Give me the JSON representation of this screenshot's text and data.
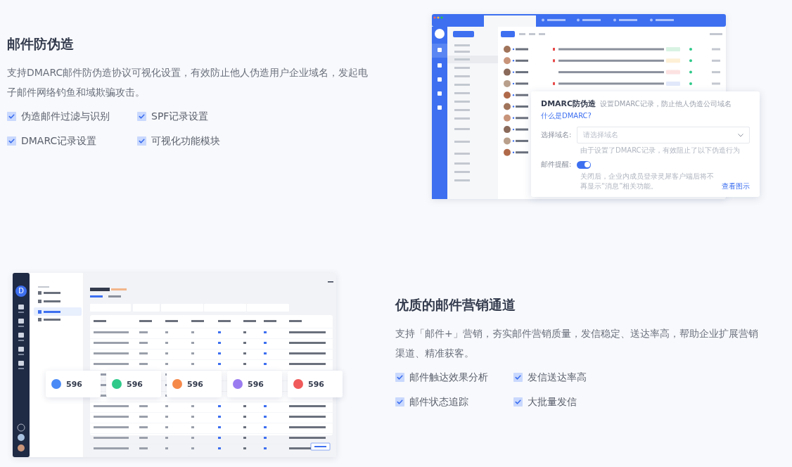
{
  "sections": [
    {
      "title": "邮件防伪造",
      "description": "支持DMARC邮件防伪造协议可视化设置，有效防止他人伪造用户企业域名，发起电子邮件网络钓鱼和域欺骗攻击。",
      "features": [
        {
          "label": "伪造邮件过滤与识别",
          "checked": true
        },
        {
          "label": "SPF记录设置",
          "checked": true
        },
        {
          "label": "DMARC记录设置",
          "checked": true
        },
        {
          "label": "可视化功能模块",
          "checked": true
        }
      ],
      "preview": {
        "kind": "mail_client",
        "dmarc_card": {
          "title": "DMARC防伪造",
          "subtitle": "设置DMARC记录，防止他人伪造公司域名",
          "help_link": "什么是DMARC?",
          "domain_label": "选择域名:",
          "domain_placeholder": "请选择域名",
          "domain_note": "由于设置了DMARC记录，有效阻止了以下伪造行为",
          "reminder_label": "邮件提醒:",
          "reminder_on": true,
          "reminder_note": "关闭后，企业内成员登录灵犀客户端后将不再显示“消息”相关功能。",
          "demo_link": "查看图示"
        }
      }
    },
    {
      "title": "优质的邮件营销通道",
      "description": "支持「邮件+」营销，夯实邮件营销质量，发信稳定、送达率高，帮助企业扩展营销渠道、精准获客。",
      "features": [
        {
          "label": "邮件触达效果分析",
          "checked": true
        },
        {
          "label": "发信送达率高",
          "checked": true
        },
        {
          "label": "邮件状态追踪",
          "checked": true
        },
        {
          "label": "大批量发信",
          "checked": true
        }
      ],
      "preview": {
        "kind": "stats_dashboard",
        "avatar_letter": "D",
        "stat_cards": [
          {
            "value": "596",
            "color": "#4a8af6"
          },
          {
            "value": "596",
            "color": "#2fc98a"
          },
          {
            "value": "596",
            "color": "#f5894a"
          },
          {
            "value": "596",
            "color": "#9b7cf0"
          },
          {
            "value": "596",
            "color": "#f05a5a"
          }
        ]
      }
    }
  ]
}
